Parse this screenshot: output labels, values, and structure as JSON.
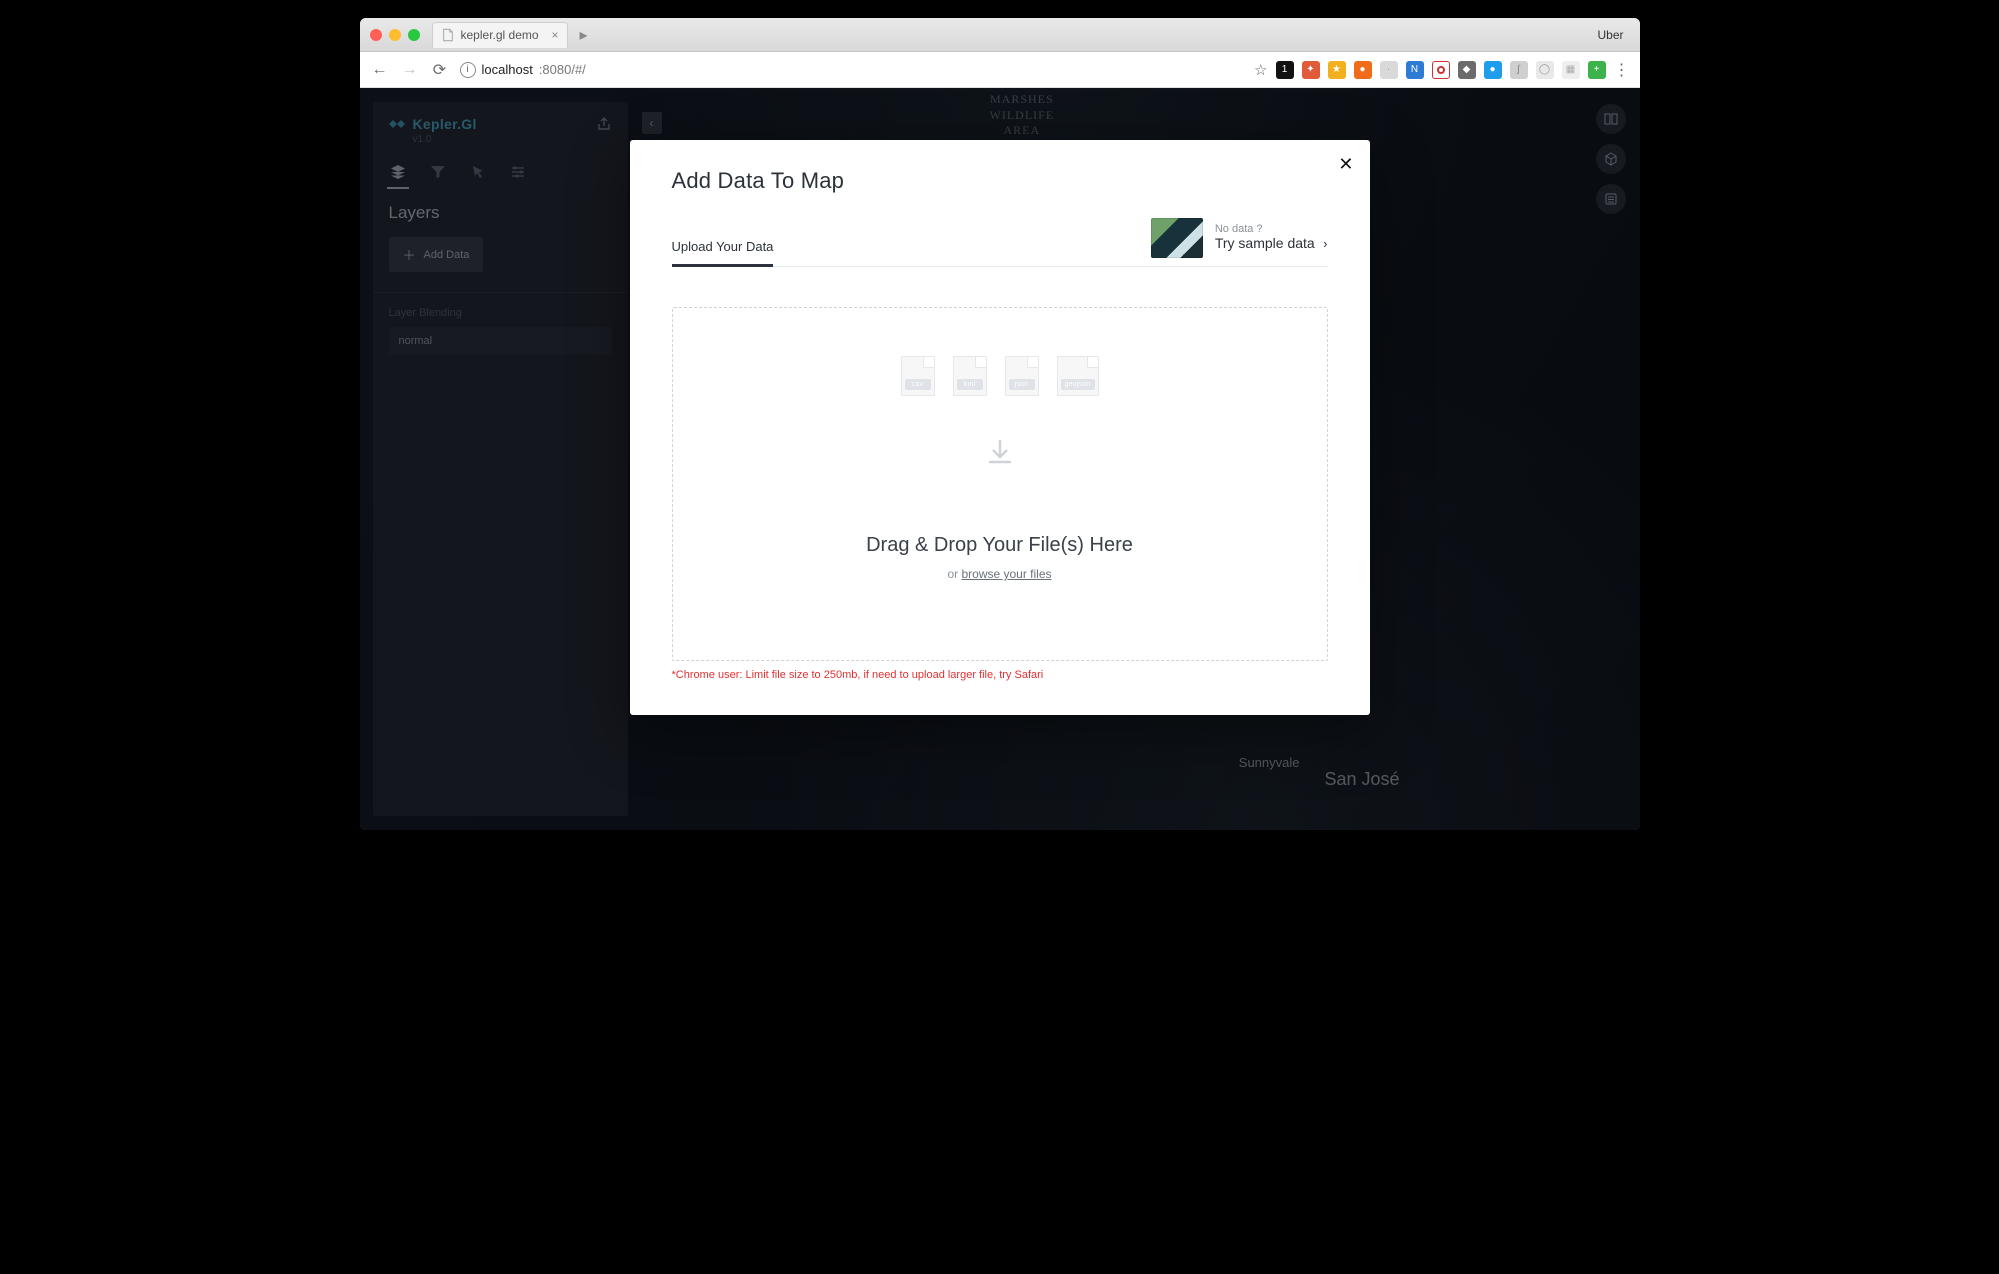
{
  "browser": {
    "tab_title": "kepler.gl demo",
    "profile_label": "Uber",
    "url_host": "localhost",
    "url_rest": ":8080/#/"
  },
  "map": {
    "top_label_lines": [
      "MARSHES",
      "WILDLIFE",
      "AREA"
    ],
    "city_sanjose": "San José",
    "city_sunnyvale": "Sunnyvale"
  },
  "side_panel": {
    "brand": "Kepler.Gl",
    "version": "v1.0",
    "title": "Layers",
    "add_data": "Add Data",
    "layer_blending_label": "Layer Blending",
    "layer_blending_value": "normal",
    "tool_icons": [
      "layers-icon",
      "funnel-icon",
      "cursor-icon",
      "sliders-icon"
    ]
  },
  "map_controls": [
    "split-map-icon",
    "3d-icon",
    "legend-icon"
  ],
  "modal": {
    "title": "Add Data To Map",
    "tab_upload": "Upload Your Data",
    "sample_prompt": "No data ?",
    "sample_cta": "Try sample data",
    "file_types": [
      "csv",
      "kml",
      "json",
      "geojson"
    ],
    "dropzone_title": "Drag & Drop Your File(s) Here",
    "dropzone_or": "or ",
    "dropzone_browse": "browse your files",
    "chrome_warning": "*Chrome user: Limit file size to 250mb, if need to upload larger file, try Safari"
  }
}
